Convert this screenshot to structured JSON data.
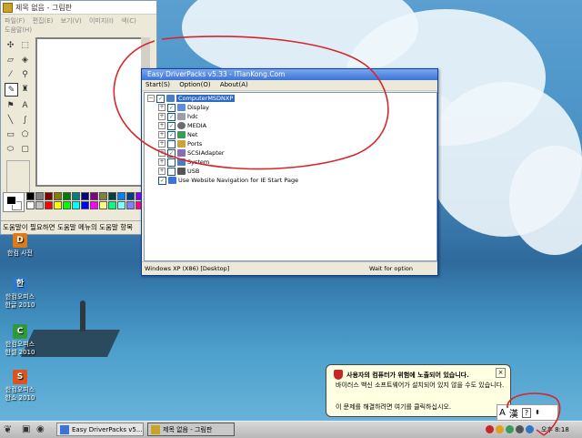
{
  "paint": {
    "title": "제목 없음 - 그림판",
    "menu": [
      "파일(F)",
      "편집(E)",
      "보기(V)",
      "이미지(I)",
      "색(C)",
      "도움말(H)"
    ],
    "status": "도움말이 필요하면 도움말 메뉴의 도움말 항목"
  },
  "edp": {
    "title": "Easy DriverPacks v5.33 - ITianKong.Com",
    "menu": [
      "Start(S)",
      "Option(O)",
      "About(A)"
    ],
    "tree": {
      "root": "ComputerMSDNXP",
      "items": [
        {
          "label": "Display",
          "checked": true
        },
        {
          "label": "hdc",
          "checked": true
        },
        {
          "label": "MEDIA",
          "checked": true
        },
        {
          "label": "Net",
          "checked": true
        },
        {
          "label": "Ports",
          "checked": false
        },
        {
          "label": "SCSIAdapter",
          "checked": true
        },
        {
          "label": "System",
          "checked": false
        },
        {
          "label": "USB",
          "checked": false
        }
      ],
      "extra": "Use Website Navigation for IE Start Page"
    },
    "status_left": "Windows XP (X86) [Desktop]",
    "status_right": "Wait for option"
  },
  "desktop_icons": [
    {
      "label1": "한컴 사전",
      "label2": "",
      "glyph": "D",
      "color": "#e07a16"
    },
    {
      "label1": "한컴오피스",
      "label2": "한글 2010",
      "glyph": "한",
      "color": "#2f79c4"
    },
    {
      "label1": "한컴오피스",
      "label2": "한셀 2010",
      "glyph": "C",
      "color": "#2e9a3c"
    },
    {
      "label1": "한컴오피스",
      "label2": "한쇼 2010",
      "glyph": "S",
      "color": "#d9541e"
    }
  ],
  "balloon": {
    "title": "사용자의 컴퓨터가 위험에 노출되어 있습니다.",
    "message": "바이러스 백신 소프트웨어가 설치되어 있지 않을 수도 있습니다.",
    "action": "이 문제를 해결하려면 여기를 클릭하십시오."
  },
  "ime": {
    "mode": "A",
    "hanja": "漢"
  },
  "taskbar": {
    "tasks": [
      "Easy DriverPacks v5....",
      "제목 없음 - 그림판"
    ],
    "clock": "오후 8:18"
  },
  "colors": {
    "annotation": "#d6262a",
    "title_blue": "#3c73d9"
  }
}
